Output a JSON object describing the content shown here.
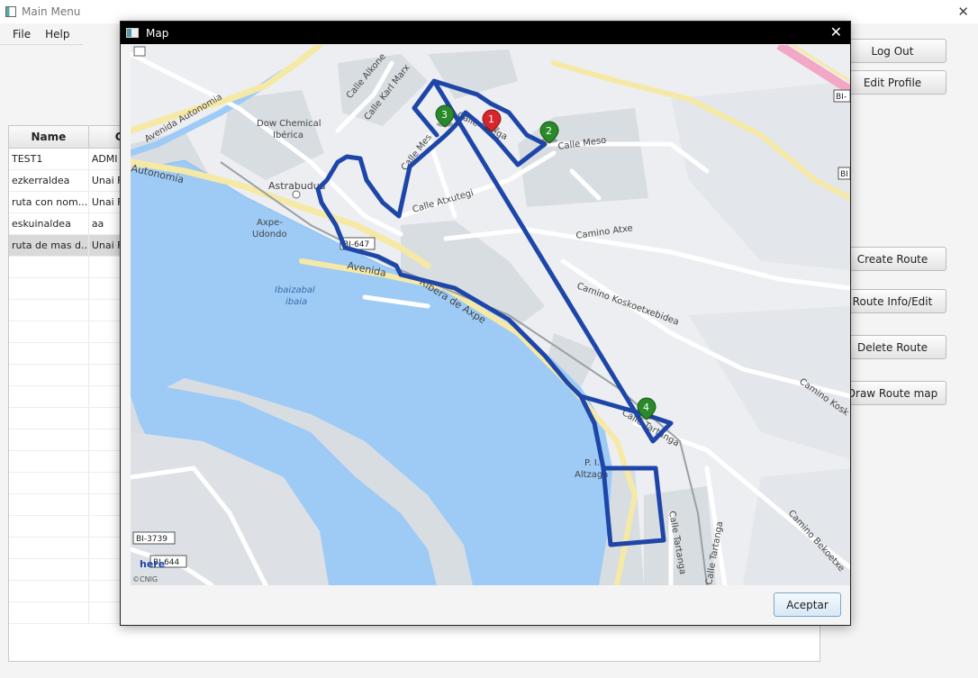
{
  "window": {
    "title": "Main Menu",
    "close": "✕"
  },
  "menu": [
    "File",
    "Help"
  ],
  "table": {
    "columns": [
      "Name",
      "Crea"
    ],
    "rows": [
      [
        "TEST1",
        "ADMI"
      ],
      [
        "ezkerraldea",
        "Unai F"
      ],
      [
        "ruta con nom...",
        "Unai F"
      ],
      [
        "eskuinaldea",
        "aa"
      ],
      [
        "ruta de mas d...",
        "Unai F"
      ]
    ],
    "selected_row": 4
  },
  "buttons": {
    "logout": "Log Out",
    "edit_profile": "Edit Profile",
    "create_route": "Create Route",
    "route_info": "Route Info/Edit",
    "delete_route": "Delete Route",
    "draw_route": "Draw Route map"
  },
  "dialog": {
    "title": "Map",
    "close": "✕",
    "accept": "Aceptar"
  },
  "map": {
    "labels": {
      "avenida_autonomia": "Avenida Autonomia",
      "autonomia": "Autonomía",
      "alkone": "Calle Alkone",
      "karl_marx": "Calle Karl Marx",
      "dow_1": "Dow Chemical",
      "dow_2": "Ibérica",
      "calle_mes": "Calle Mes",
      "calle_ollega": "Calle Ollega",
      "calle_meso": "Calle Meso",
      "astrabudua": "Astrabudua",
      "calle_atxutegi": "Calle Atxutegi",
      "axpe": "Axpe-",
      "udondo": "Udondo",
      "bi647": "BI-647",
      "camino_atxe": "Camino Atxe",
      "avenida": "Avenida",
      "ribera": "Ribera de Axpe",
      "ibaizabal": "Ibaizabal",
      "ibaia": "ibaia",
      "koskoetxe": "Camino Koskoetxebidea",
      "camino_kosk": "Camino Kosk",
      "calle_tartanga": "Calle Tartanga",
      "pi": "P. I.",
      "altzaga": "Altzaga",
      "calle_tartanga_v": "Calle Tartanga",
      "calle_tartanga_v2": "Calle Tartanga",
      "camino_bekoetxe": "Camino Bekoetxe",
      "bi3739": "BI-3739",
      "bi644": "BI-644",
      "here": "here",
      "cnig": "©CNIG",
      "bi_right1": "BI-",
      "bi_right2": "BI"
    },
    "markers": [
      "1",
      "2",
      "3",
      "4"
    ],
    "route_color": "#1d46a8",
    "water_color": "#9ecbf6",
    "accent_marker": "#d8262c",
    "waypoint_marker": "#2a8a2a"
  }
}
